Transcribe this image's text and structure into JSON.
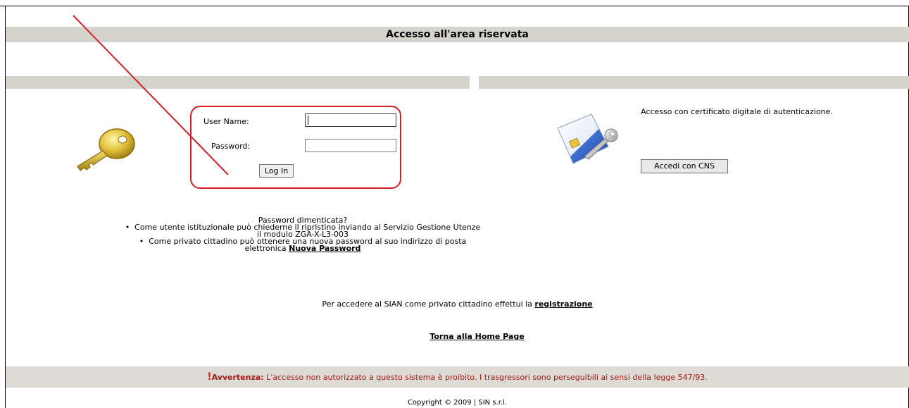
{
  "page": {
    "title": "Accesso all'area riservata"
  },
  "login": {
    "username_label": "User Name:",
    "password_label": "Password:",
    "username_value": "",
    "password_value": "",
    "login_button": "Log In"
  },
  "certificate": {
    "description": "Accesso con certificato digitale di autenticazione.",
    "button": "Accedi con CNS"
  },
  "forgot": {
    "heading": "Password dimenticata?",
    "item1_line1": "Come utente istituzionale può chiederne il ripristino inviando al Servizio Gestione Utenze",
    "item1_line2": "il modulo ZGA-X-L3-003",
    "item2_line1": "Come privato cittadino può ottenere una nuova password al suo indirizzo di posta",
    "item2_line2_prefix": "elettronica",
    "item2_link": "Nuova Password"
  },
  "registration": {
    "text": "Per accedere al SIAN come privato cittadino effettui la",
    "link": "registrazione"
  },
  "home_link": "Torna alla Home Page",
  "warning": {
    "icon": "!",
    "label": "Avvertenza:",
    "text": "L'accesso non autorizzato a questo sistema è proibito. I trasgressori sono perseguibili ai sensi della legge 547/93."
  },
  "copyright": "Copyright © 2009 | SIN s.r.l.",
  "colors": {
    "bar": "#d4d4cc",
    "warning_text": "#a31a12",
    "annotation": "#d41f2a"
  }
}
